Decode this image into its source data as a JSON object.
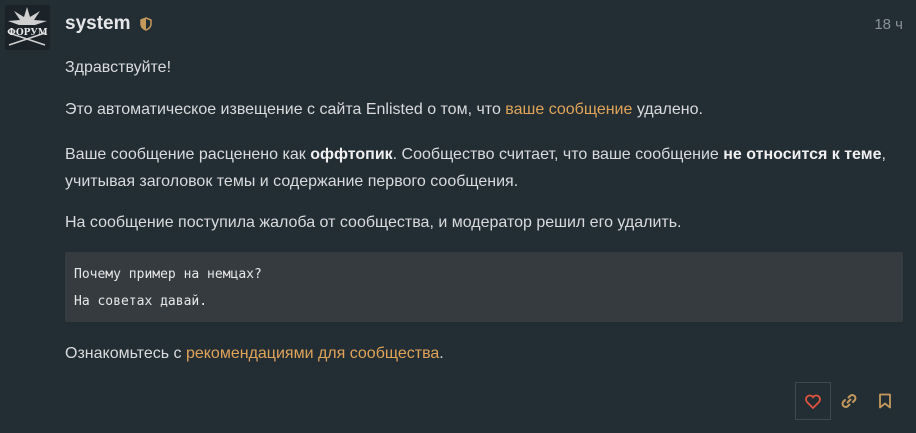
{
  "post": {
    "username": "system",
    "time": "18 ч",
    "avatar_text": "ФОРУМ"
  },
  "message": {
    "greeting": "Здравствуйте!",
    "p1_before": "Это автоматическое извещение с сайта Enlisted о том, что ",
    "p1_link": "ваше сообщение",
    "p1_after": " удалено.",
    "p2_a": "Ваше сообщение расценено как ",
    "p2_b": "оффтопик",
    "p2_c": ". Сообщество считает, что ваше сообщение ",
    "p2_d": "не относится к теме",
    "p2_e": ",",
    "p2_line2": "учитывая заголовок темы и содержание первого сообщения.",
    "p3": "На сообщение поступила жалоба от сообщества, и модератор решил его удалить.",
    "quote_line1": "Почему пример на немцах?",
    "quote_line2": "На советах давай.",
    "p4_before": "Ознакомьтесь с ",
    "p4_link": "рекомендациями для сообщества",
    "p4_after": "."
  },
  "colors": {
    "background": "#232d34",
    "link": "#e0a459",
    "like_icon": "#e0533f",
    "muted_icon": "#c49a5c"
  },
  "icons": [
    "shield-icon",
    "heart-icon",
    "link-icon",
    "bookmark-icon"
  ]
}
